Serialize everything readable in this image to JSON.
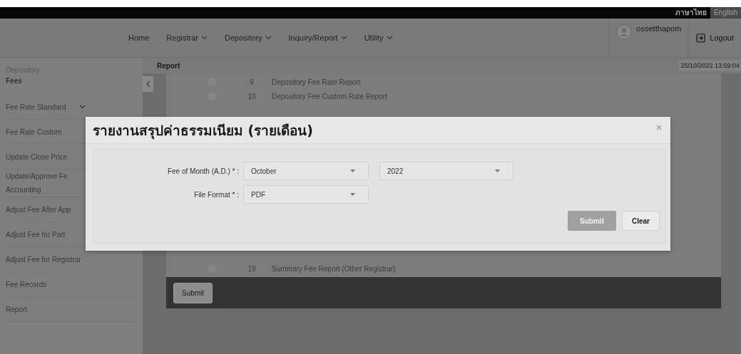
{
  "language_bar": [
    {
      "label": "ภาษาไทย",
      "selected": true
    },
    {
      "label": "English",
      "selected": false
    }
  ],
  "nav": [
    {
      "label": "Home",
      "dropdown": false
    },
    {
      "label": "Registrar",
      "dropdown": true
    },
    {
      "label": "Depository",
      "dropdown": true
    },
    {
      "label": "Inquiry/Report",
      "dropdown": true
    },
    {
      "label": "Utility",
      "dropdown": true
    }
  ],
  "user": {
    "name": "ossetthapom",
    "logout": "Logout"
  },
  "sidebar": {
    "section": "Depository",
    "title": "Fees",
    "items": [
      {
        "label": "Fee Rate Standard",
        "expandable": true
      },
      {
        "label": "Fee Rate Custom",
        "expandable": false
      },
      {
        "label": "Update Close Price",
        "expandable": false
      },
      {
        "label": "Update/Approve Fe\nAccounting",
        "expandable": false
      },
      {
        "label": "Adjust Fee After App",
        "expandable": false
      },
      {
        "label": "Adjust Fee for Part",
        "expandable": false
      },
      {
        "label": "Adjust Fee for Registrar",
        "expandable": false
      },
      {
        "label": "Fee Records",
        "expandable": false
      },
      {
        "label": "Report",
        "expandable": false
      }
    ]
  },
  "breadcrumb": "Report",
  "datetime": "25/10/2022 13:59:04",
  "report_list": [
    {
      "number": "9",
      "name": "Depository Fee Rate Report",
      "selected": false
    },
    {
      "number": "10",
      "name": "Depository Fee Custom Rate Report",
      "selected": false
    },
    {
      "number": "19",
      "name": "Summary Fee Report (Other Registrar)",
      "selected": false
    }
  ],
  "list_button": "Submit",
  "dialog": {
    "title": "รายงานสรุปค่าธรรมเนียม (รายเดือน)",
    "fields": [
      {
        "label": "Fee of Month (A.D.) * :",
        "selects": [
          "October",
          "2022"
        ]
      },
      {
        "label": "File Format * :",
        "selects": [
          "PDF"
        ]
      }
    ],
    "buttons": [
      {
        "label": "Submit",
        "disabled": true
      },
      {
        "label": "Clear",
        "disabled": false
      }
    ]
  }
}
